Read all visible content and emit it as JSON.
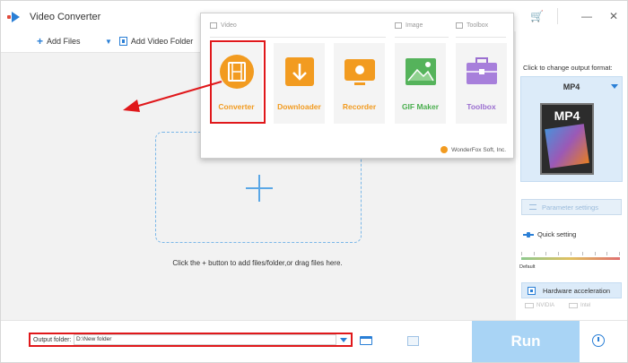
{
  "window": {
    "title": "Video Converter"
  },
  "toolbar": {
    "add_files": "Add Files",
    "add_video_folder": "Add Video Folder"
  },
  "main": {
    "hint": "Click the + button to add files/folder,or drag files here."
  },
  "popup": {
    "categories": [
      "Video",
      "Image",
      "Toolbox"
    ],
    "tiles": [
      {
        "label": "Converter",
        "icon": "film-reel-icon"
      },
      {
        "label": "Downloader",
        "icon": "download-icon"
      },
      {
        "label": "Recorder",
        "icon": "screen-recorder-icon"
      },
      {
        "label": "GIF Maker",
        "icon": "image-landscape-icon"
      },
      {
        "label": "Toolbox",
        "icon": "toolbox-icon"
      }
    ],
    "brand": "WonderFox Soft, Inc."
  },
  "right_panel": {
    "change_format_label": "Click to change output format:",
    "format_name": "MP4",
    "format_badge": "MP4",
    "parameter_settings": "Parameter settings",
    "quick_setting": "Quick setting",
    "slider_default": "Default",
    "hardware_acceleration": "Hardware acceleration",
    "gpu_options": [
      "NVIDIA",
      "Intel"
    ]
  },
  "bottom": {
    "output_folder_label": "Output folder:",
    "output_folder_value": "D:\\New folder",
    "run_label": "Run"
  },
  "colors": {
    "accent": "#2a7fd6",
    "tile_orange": "#f29b20",
    "highlight_red": "#e0181b",
    "run_disabled": "#a9d4f5"
  }
}
